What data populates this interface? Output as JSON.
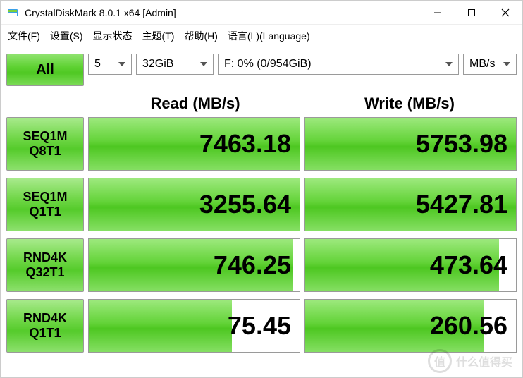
{
  "window": {
    "title": "CrystalDiskMark 8.0.1 x64 [Admin]"
  },
  "menu": {
    "file": "文件(F)",
    "settings": "设置(S)",
    "display": "显示状态",
    "theme": "主题(T)",
    "help": "帮助(H)",
    "language": "语言(L)(Language)"
  },
  "controls": {
    "all_label": "All",
    "count": "5",
    "size": "32GiB",
    "drive": "F: 0% (0/954GiB)",
    "unit": "MB/s"
  },
  "headers": {
    "read": "Read (MB/s)",
    "write": "Write (MB/s)"
  },
  "tests": [
    {
      "label1": "SEQ1M",
      "label2": "Q8T1",
      "read": "7463.18",
      "write": "5753.98",
      "read_fill": 100,
      "write_fill": 100
    },
    {
      "label1": "SEQ1M",
      "label2": "Q1T1",
      "read": "3255.64",
      "write": "5427.81",
      "read_fill": 100,
      "write_fill": 100
    },
    {
      "label1": "RND4K",
      "label2": "Q32T1",
      "read": "746.25",
      "write": "473.64",
      "read_fill": 97,
      "write_fill": 92
    },
    {
      "label1": "RND4K",
      "label2": "Q1T1",
      "read": "75.45",
      "write": "260.56",
      "read_fill": 68,
      "write_fill": 85
    }
  ],
  "watermark": {
    "badge": "值",
    "text": "什么值得买"
  },
  "colors": {
    "accent_green": "#55cb2b",
    "border_gray": "#9a9a9a"
  },
  "chart_data": {
    "type": "table",
    "title": "CrystalDiskMark 8.0.1 x64",
    "columns": [
      "Test",
      "Read (MB/s)",
      "Write (MB/s)"
    ],
    "rows": [
      [
        "SEQ1M Q8T1",
        7463.18,
        5753.98
      ],
      [
        "SEQ1M Q1T1",
        3255.64,
        5427.81
      ],
      [
        "RND4K Q32T1",
        746.25,
        473.64
      ],
      [
        "RND4K Q1T1",
        75.45,
        260.56
      ]
    ],
    "settings": {
      "runs": 5,
      "test_size": "32GiB",
      "drive": "F: 0% (0/954GiB)",
      "unit": "MB/s"
    }
  }
}
